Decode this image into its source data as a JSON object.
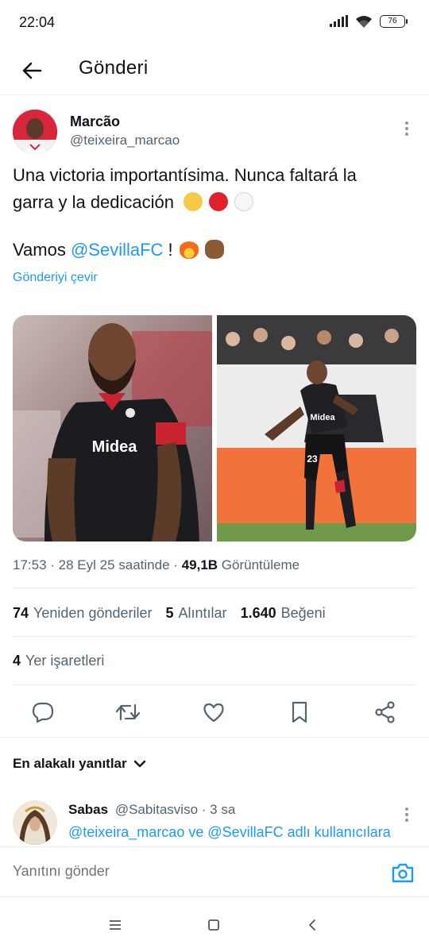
{
  "status_bar": {
    "time": "22:04",
    "battery": "76"
  },
  "header": {
    "title": "Gönderi"
  },
  "tweet": {
    "author_name": "Marcão",
    "author_handle": "@teixeira_marcao",
    "text_line1": "Una victoria importantísima. Nunca faltará la",
    "text_line2": "garra y la dedicación",
    "text_line3_prefix": "Vamos ",
    "text_mention": "@SevillaFC",
    "text_line3_suffix": " ! ",
    "translate": "Gönderiyi çevir",
    "time": "17:53",
    "date": "28 Eyl 25 saatinde",
    "views_count": "49,1B",
    "views_label": "Görüntüleme",
    "reposts_count": "74",
    "reposts_label": "Yeniden gönderiler",
    "quotes_count": "5",
    "quotes_label": "Alıntılar",
    "likes_count": "1.640",
    "likes_label": "Beğeni",
    "bookmarks_count": "4",
    "bookmarks_label": "Yer işaretleri",
    "photo_text_1": "Midea",
    "photo_text_2": "Midea",
    "photo_number_2": "23"
  },
  "icons": {
    "back": "arrow-left-icon",
    "reply": "reply-icon",
    "repost": "repost-icon",
    "like": "heart-icon",
    "bookmark": "bookmark-icon",
    "share": "share-icon",
    "camera": "camera-icon"
  },
  "replies": {
    "sort_label": "En alakalı yanıtlar",
    "items": [
      {
        "name": "Sabas",
        "handle": "@Sabitasviso",
        "time": "· 3 sa",
        "mention1": "@teixeira_marcao",
        "connector": " ve ",
        "mention2": "@SevillaFC",
        "rest": " adlı kullanıcılara"
      }
    ]
  },
  "composer": {
    "placeholder": "Yanıtını gönder"
  },
  "colors": {
    "accent": "#1d9bf0",
    "text": "#0f1419",
    "muted": "#536471",
    "sevilla_red": "#d8263a"
  }
}
